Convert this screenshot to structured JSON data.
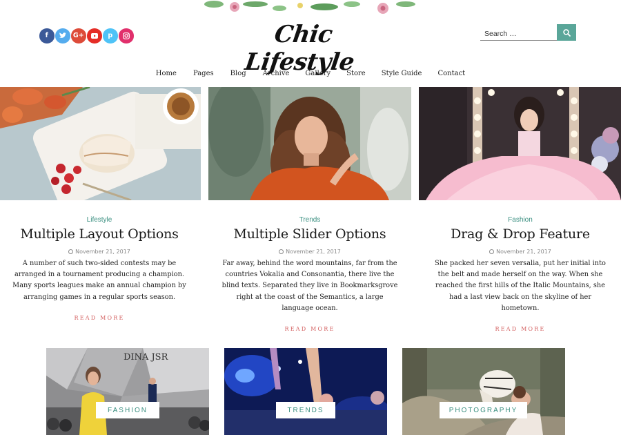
{
  "site": {
    "logo_text": "Chic Lifestyle"
  },
  "social": [
    {
      "name": "facebook",
      "glyph": "f",
      "color": "#3b5998"
    },
    {
      "name": "twitter",
      "glyph": "t",
      "color": "#55acee"
    },
    {
      "name": "google-plus",
      "glyph": "G+",
      "color": "#dd4b39"
    },
    {
      "name": "youtube",
      "glyph": "▶",
      "color": "#e52d27"
    },
    {
      "name": "pinterest",
      "glyph": "p",
      "color": "#4fc3f7"
    },
    {
      "name": "instagram",
      "glyph": "◎",
      "color": "#e1306c"
    }
  ],
  "search": {
    "placeholder": "Search …",
    "button_icon": "search-icon",
    "button_color": "#5aa699"
  },
  "nav": {
    "items": [
      "Home",
      "Pages",
      "Blog",
      "Archive",
      "Gallery",
      "Store",
      "Style Guide",
      "Contact"
    ]
  },
  "posts": [
    {
      "category": "Lifestyle",
      "title": "Multiple Layout Options",
      "date": "November 21, 2017",
      "excerpt": "A number of such two-sided contests may be arranged in a tournament producing a champion. Many sports leagues make an annual champion by arranging games in a regular sports season.",
      "read_more": "READ MORE"
    },
    {
      "category": "Trends",
      "title": "Multiple Slider Options",
      "date": "November 21, 2017",
      "excerpt": "Far away, behind the word mountains, far from the countries Vokalia and Consonantia, there live the blind texts. Separated they live in Bookmarksgrove right at the coast of the Semantics, a large language ocean.",
      "read_more": "READ MORE"
    },
    {
      "category": "Fashion",
      "title": "Drag & Drop Feature",
      "date": "November 21, 2017",
      "excerpt": "She packed her seven versalia, put her initial into the belt and made herself on the way. When she reached the first hills of the Italic Mountains, she had a last view back on the skyline of her hometown.",
      "read_more": "READ MORE"
    }
  ],
  "categories": [
    {
      "label": "FASHION",
      "sign_text": "DINA JSR"
    },
    {
      "label": "TRENDS"
    },
    {
      "label": "PHOTOGRAPHY"
    }
  ],
  "colors": {
    "accent": "#3a8f80",
    "read_more": "#d36060"
  }
}
